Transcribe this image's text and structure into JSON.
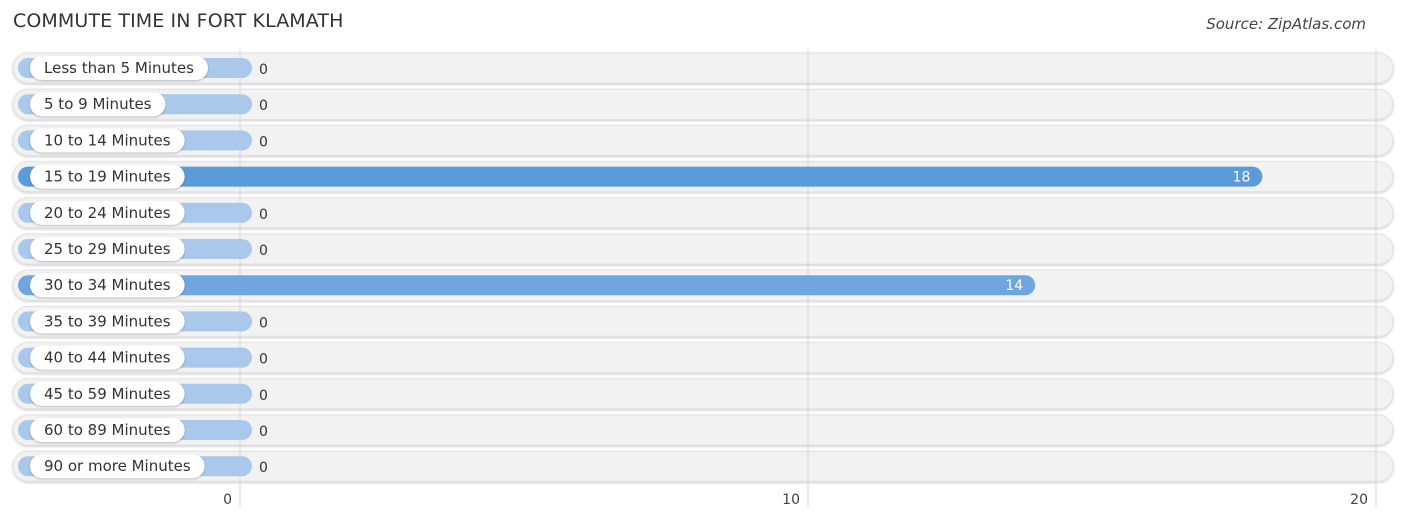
{
  "header": {
    "title": "COMMUTE TIME IN FORT KLAMATH",
    "source": "Source: ZipAtlas.com"
  },
  "colors": {
    "bar_strong": "#5b9bd9",
    "bar_light": "#a9c8ec",
    "track": "#f2f2f2",
    "grid": "#d8d8d8"
  },
  "chart_data": {
    "type": "bar",
    "orientation": "horizontal",
    "title": "COMMUTE TIME IN FORT KLAMATH",
    "xlabel": "",
    "ylabel": "",
    "categories": [
      "Less than 5 Minutes",
      "5 to 9 Minutes",
      "10 to 14 Minutes",
      "15 to 19 Minutes",
      "20 to 24 Minutes",
      "25 to 29 Minutes",
      "30 to 34 Minutes",
      "35 to 39 Minutes",
      "40 to 44 Minutes",
      "45 to 59 Minutes",
      "60 to 89 Minutes",
      "90 or more Minutes"
    ],
    "values": [
      0,
      0,
      0,
      18,
      0,
      0,
      14,
      0,
      0,
      0,
      0,
      0
    ],
    "xlim": [
      0,
      20
    ],
    "xticks": [
      0,
      10,
      20
    ],
    "grid": true,
    "legend": "none"
  }
}
